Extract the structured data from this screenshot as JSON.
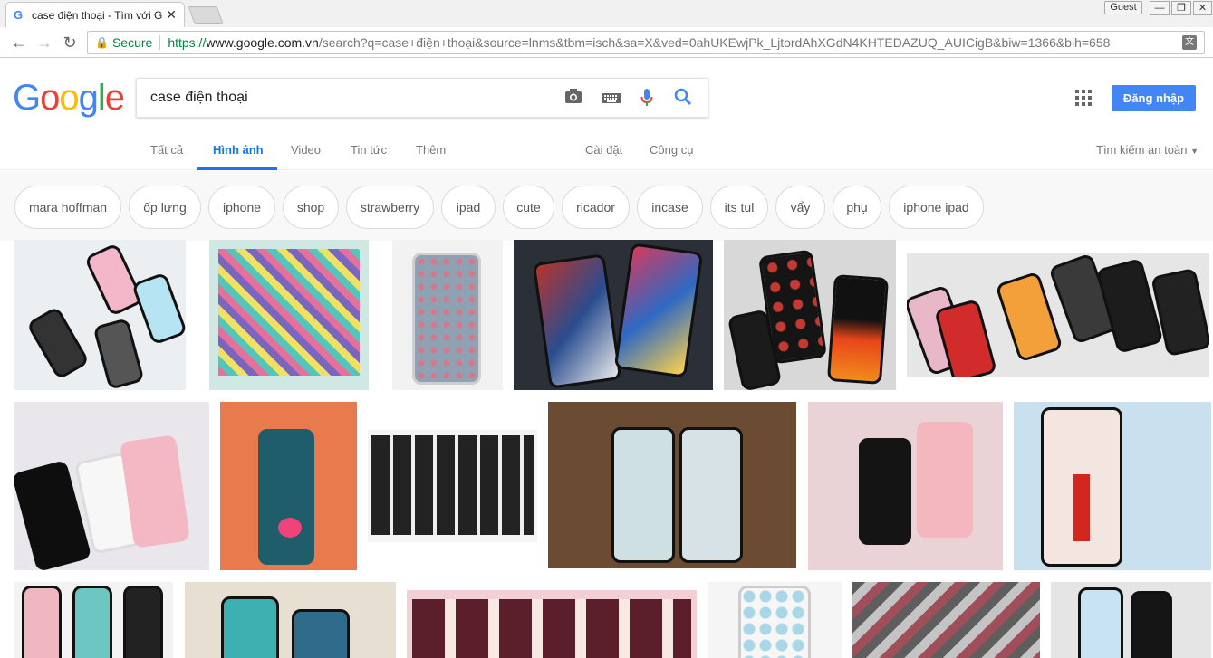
{
  "browser": {
    "tab_title": "case điện thoại - Tìm với Go",
    "guest_label": "Guest",
    "secure_label": "Secure",
    "url_scheme": "https://",
    "url_host": "www.google.com.vn",
    "url_rest": "/search?q=case+điện+thoại&source=lnms&tbm=isch&sa=X&ved=0ahUKEwjPk_LjtordAhXGdN4KHTEDAZUQ_AUICigB&biw=1366&bih=658"
  },
  "header": {
    "logo": [
      "G",
      "o",
      "o",
      "g",
      "l",
      "e"
    ],
    "logo_colors": [
      "#4285f4",
      "#ea4335",
      "#fbbc05",
      "#4285f4",
      "#34a853",
      "#ea4335"
    ],
    "query": "case điện thoại",
    "signin_label": "Đăng nhập"
  },
  "tabs": {
    "all": "Tất cả",
    "images": "Hình ảnh",
    "video": "Video",
    "news": "Tin tức",
    "more": "Thêm",
    "settings": "Cài đặt",
    "tools": "Công cụ",
    "safesearch": "Tìm kiếm an toàn"
  },
  "chips": [
    "mara hoffman",
    "ốp lưng",
    "iphone",
    "shop",
    "strawberry",
    "ipad",
    "cute",
    "ricador",
    "incase",
    "its tul",
    "vẩy",
    "phụ",
    "iphone ipad"
  ],
  "image_colors": {
    "blue_accent": "#1a73e8",
    "brand_blue": "#4285f4"
  }
}
